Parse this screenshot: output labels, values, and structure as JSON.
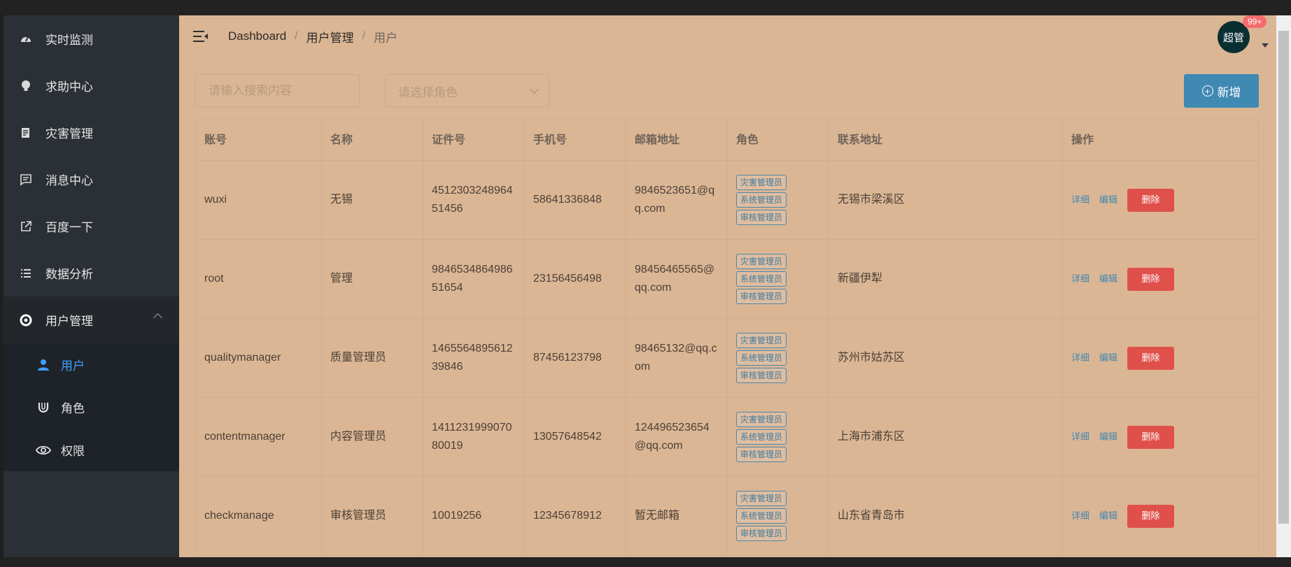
{
  "sidebar": {
    "items": [
      {
        "label": "实时监测",
        "icon": "dashboard-icon"
      },
      {
        "label": "求助中心",
        "icon": "bulb-icon"
      },
      {
        "label": "灾害管理",
        "icon": "document-icon"
      },
      {
        "label": "消息中心",
        "icon": "message-icon"
      },
      {
        "label": "百度一下",
        "icon": "external-link-icon"
      },
      {
        "label": "数据分析",
        "icon": "list-icon"
      },
      {
        "label": "用户管理",
        "icon": "lifebuoy-icon",
        "expanded": true
      }
    ],
    "subitems": [
      {
        "label": "用户",
        "icon": "user-icon",
        "active": true
      },
      {
        "label": "角色",
        "icon": "magnet-icon"
      },
      {
        "label": "权限",
        "icon": "eye-icon"
      }
    ]
  },
  "header": {
    "breadcrumb": [
      "Dashboard",
      "用户管理",
      "用户"
    ],
    "avatar_text": "超管",
    "badge": "99+"
  },
  "toolbar": {
    "search_placeholder": "请输入搜索内容",
    "role_placeholder": "请选择角色",
    "add_label": "新增"
  },
  "table": {
    "columns": [
      "账号",
      "名称",
      "证件号",
      "手机号",
      "邮箱地址",
      "角色",
      "联系地址",
      "操作"
    ],
    "rows": [
      {
        "account": "wuxi",
        "name": "无锡",
        "id_number": "451230324896451456",
        "phone": "58641336848",
        "email": "9846523651@qq.com",
        "roles": [
          "灾害管理员",
          "系统管理员",
          "审核管理员"
        ],
        "address": "无锡市梁溪区"
      },
      {
        "account": "root",
        "name": "管理",
        "id_number": "984653486498651654",
        "phone": "23156456498",
        "email": "98456465565@qq.com",
        "roles": [
          "灾害管理员",
          "系统管理员",
          "审核管理员"
        ],
        "address": "新疆伊犁"
      },
      {
        "account": "qualitymanager",
        "name": "质量管理员",
        "id_number": "146556489561239846",
        "phone": "87456123798",
        "email": "98465132@qq.com",
        "roles": [
          "灾害管理员",
          "系统管理员",
          "审核管理员"
        ],
        "address": "苏州市姑苏区"
      },
      {
        "account": "contentmanager",
        "name": "内容管理员",
        "id_number": "141123199907080019",
        "phone": "13057648542",
        "email": "124496523654@qq.com",
        "roles": [
          "灾害管理员",
          "系统管理员",
          "审核管理员"
        ],
        "address": "上海市浦东区"
      },
      {
        "account": "checkmanage",
        "name": "审核管理员",
        "id_number": "10019256",
        "phone": "12345678912",
        "email": "暂无邮箱",
        "roles": [
          "灾害管理员",
          "系统管理员",
          "审核管理员"
        ],
        "address": "山东省青岛市"
      }
    ],
    "actions": {
      "detail": "详细",
      "edit": "编辑",
      "delete": "删除"
    }
  },
  "colors": {
    "sidebar_bg": "#2b3036",
    "submenu_bg": "#1e2329",
    "main_bg": "#dbb694",
    "primary": "#409eff",
    "add_button": "#3f89b3",
    "delete_button": "#e0504a",
    "avatar_bg": "#0a2f33"
  }
}
